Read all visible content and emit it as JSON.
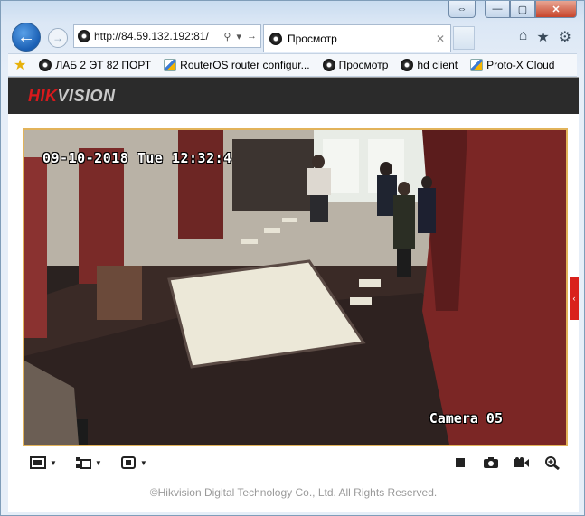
{
  "browser": {
    "url": "http://84.59.132.192:81/",
    "tab_title": "Просмотр",
    "caption": {
      "restore": "⇔",
      "minimize": "—",
      "maximize": "▢",
      "close": "✕"
    },
    "icons": [
      "back-arrow-icon",
      "forward-arrow-icon",
      "search-icon",
      "refresh-icon",
      "home-icon",
      "star-icon",
      "gear-icon"
    ]
  },
  "favorites": [
    {
      "label": "ЛАБ 2 ЭТ 82 ПОРТ",
      "icon": "camera-site-icon"
    },
    {
      "label": "RouterOS router configur...",
      "icon": "page-icon"
    },
    {
      "label": "Просмотр",
      "icon": "camera-site-icon"
    },
    {
      "label": "hd client",
      "icon": "camera-site-icon"
    },
    {
      "label": "Proto-X Cloud",
      "icon": "page-icon"
    }
  ],
  "hikvision": {
    "logo_red": "HIK",
    "logo_grey": "VISION",
    "osd_datetime": "09-10-2018 Tue 12:32:4",
    "osd_camera": "Camera 05",
    "footer": "©Hikvision Digital Technology Co., Ltd. All Rights Reserved."
  },
  "toolbar": {
    "left": [
      "window-layout-icon",
      "stream-type-icon",
      "aspect-ratio-icon"
    ],
    "right": [
      "stop-icon",
      "snapshot-icon",
      "record-icon",
      "digital-zoom-icon"
    ]
  },
  "colors": {
    "accent": "#d7191c",
    "video_border": "#e2b35a",
    "header_bg": "#2b2b2b"
  }
}
